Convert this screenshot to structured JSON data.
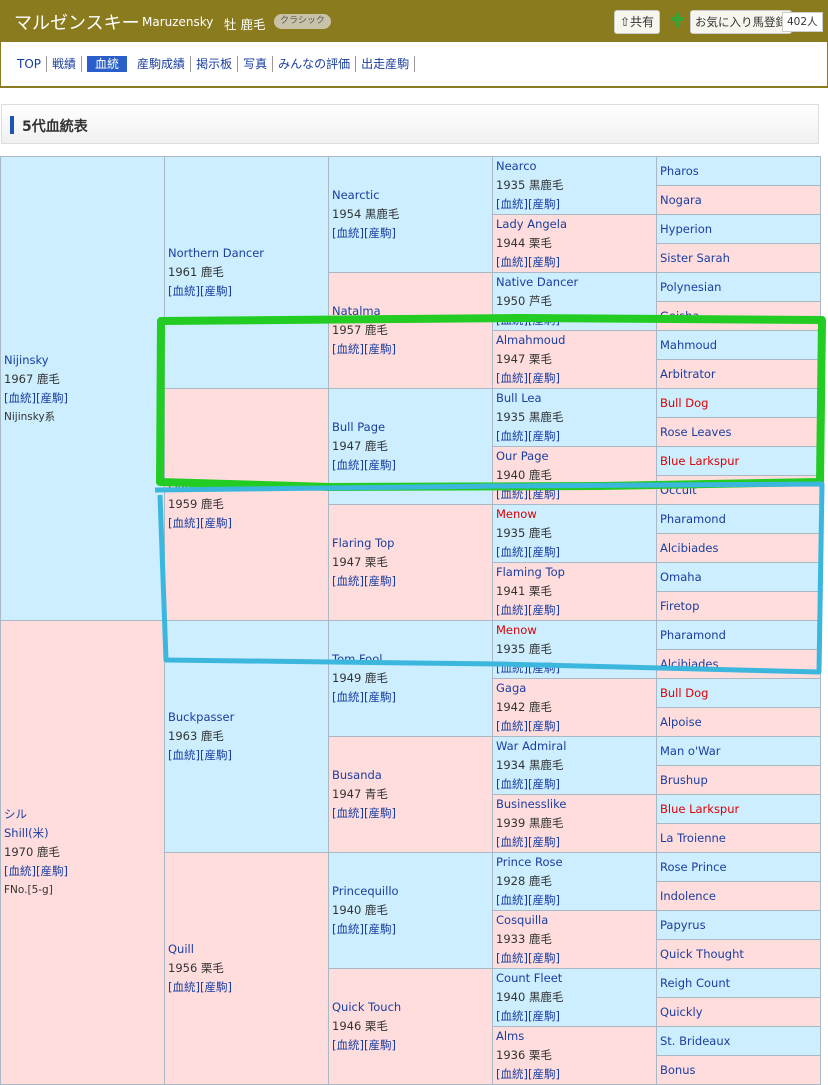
{
  "header": {
    "name": "マルゼンスキー",
    "roman": "Maruzensky",
    "sex_color": "牡 鹿毛",
    "badge": "クラシック",
    "share": "⇧共有",
    "favorite": "お気に入り馬登録",
    "fav_count": "402人"
  },
  "nav": [
    {
      "label": "TOP",
      "active": false
    },
    {
      "label": "戦績",
      "active": false
    },
    {
      "label": "血統",
      "active": true
    },
    {
      "label": "産駒成績",
      "active": false
    },
    {
      "label": "掲示板",
      "active": false
    },
    {
      "label": "写真",
      "active": false
    },
    {
      "label": "みんなの評価",
      "active": false
    },
    {
      "label": "出走産駒",
      "active": false
    }
  ],
  "section_title": "5代血統表",
  "links": {
    "pedigree": "血統",
    "progeny": "産駒"
  },
  "gen1": [
    {
      "name": "Nijinsky",
      "info": "1967 鹿毛",
      "extra": "Nijinsky系",
      "sex": "m"
    },
    {
      "kana": "シル",
      "name": "Shill(米)",
      "info": "1970 鹿毛",
      "extra": "FNo.[5-g]",
      "sex": "f"
    }
  ],
  "gen2": [
    {
      "name": "Northern Dancer",
      "info": "1961 鹿毛",
      "sex": "m"
    },
    {
      "name": "Flaming Page",
      "info": "1959 鹿毛",
      "sex": "f"
    },
    {
      "name": "Buckpasser",
      "info": "1963 鹿毛",
      "sex": "m"
    },
    {
      "name": "Quill",
      "info": "1956 栗毛",
      "sex": "f"
    }
  ],
  "gen3": [
    {
      "name": "Nearctic",
      "info": "1954 黒鹿毛",
      "sex": "m"
    },
    {
      "name": "Natalma",
      "info": "1957 鹿毛",
      "sex": "f"
    },
    {
      "name": "Bull Page",
      "info": "1947 鹿毛",
      "sex": "m"
    },
    {
      "name": "Flaring Top",
      "info": "1947 栗毛",
      "sex": "f"
    },
    {
      "name": "Tom Fool",
      "info": "1949 鹿毛",
      "sex": "m"
    },
    {
      "name": "Busanda",
      "info": "1947 青毛",
      "sex": "f"
    },
    {
      "name": "Princequillo",
      "info": "1940 鹿毛",
      "sex": "m"
    },
    {
      "name": "Quick Touch",
      "info": "1946 栗毛",
      "sex": "f"
    }
  ],
  "gen4": [
    {
      "name": "Nearco",
      "info": "1935 黒鹿毛",
      "sex": "m"
    },
    {
      "name": "Lady Angela",
      "info": "1944 栗毛",
      "sex": "f"
    },
    {
      "name": "Native Dancer",
      "info": "1950 芦毛",
      "sex": "m"
    },
    {
      "name": "Almahmoud",
      "info": "1947 栗毛",
      "sex": "f"
    },
    {
      "name": "Bull Lea",
      "info": "1935 黒鹿毛",
      "sex": "m"
    },
    {
      "name": "Our Page",
      "info": "1940 鹿毛",
      "sex": "f"
    },
    {
      "name": "Menow",
      "info": "1935 鹿毛",
      "sex": "m",
      "red": true
    },
    {
      "name": "Flaming Top",
      "info": "1941 栗毛",
      "sex": "f"
    },
    {
      "name": "Menow",
      "info": "1935 鹿毛",
      "sex": "m",
      "red": true
    },
    {
      "name": "Gaga",
      "info": "1942 鹿毛",
      "sex": "f"
    },
    {
      "name": "War Admiral",
      "info": "1934 黒鹿毛",
      "sex": "m"
    },
    {
      "name": "Businesslike",
      "info": "1939 黒鹿毛",
      "sex": "f"
    },
    {
      "name": "Prince Rose",
      "info": "1928 鹿毛",
      "sex": "m"
    },
    {
      "name": "Cosquilla",
      "info": "1933 鹿毛",
      "sex": "f"
    },
    {
      "name": "Count Fleet",
      "info": "1940 黒鹿毛",
      "sex": "m"
    },
    {
      "name": "Alms",
      "info": "1936 栗毛",
      "sex": "f"
    }
  ],
  "gen5": [
    {
      "name": "Pharos",
      "sex": "m"
    },
    {
      "name": "Nogara",
      "sex": "f"
    },
    {
      "name": "Hyperion",
      "sex": "m"
    },
    {
      "name": "Sister Sarah",
      "sex": "f"
    },
    {
      "name": "Polynesian",
      "sex": "m"
    },
    {
      "name": "Geisha",
      "sex": "f"
    },
    {
      "name": "Mahmoud",
      "sex": "m"
    },
    {
      "name": "Arbitrator",
      "sex": "f"
    },
    {
      "name": "Bull Dog",
      "sex": "m",
      "red": true
    },
    {
      "name": "Rose Leaves",
      "sex": "f"
    },
    {
      "name": "Blue Larkspur",
      "sex": "m",
      "red": true
    },
    {
      "name": "Occult",
      "sex": "f"
    },
    {
      "name": "Pharamond",
      "sex": "m"
    },
    {
      "name": "Alcibiades",
      "sex": "f"
    },
    {
      "name": "Omaha",
      "sex": "m"
    },
    {
      "name": "Firetop",
      "sex": "f"
    },
    {
      "name": "Pharamond",
      "sex": "m"
    },
    {
      "name": "Alcibiades",
      "sex": "f"
    },
    {
      "name": "Bull Dog",
      "sex": "m",
      "red": true
    },
    {
      "name": "Alpoise",
      "sex": "f"
    },
    {
      "name": "Man o'War",
      "sex": "m"
    },
    {
      "name": "Brushup",
      "sex": "f"
    },
    {
      "name": "Blue Larkspur",
      "sex": "m",
      "red": true
    },
    {
      "name": "La Troienne",
      "sex": "f"
    },
    {
      "name": "Rose Prince",
      "sex": "m"
    },
    {
      "name": "Indolence",
      "sex": "f"
    },
    {
      "name": "Papyrus",
      "sex": "m"
    },
    {
      "name": "Quick Thought",
      "sex": "f"
    },
    {
      "name": "Reigh Count",
      "sex": "m"
    },
    {
      "name": "Quickly",
      "sex": "f"
    },
    {
      "name": "St. Brideaux",
      "sex": "m"
    },
    {
      "name": "Bonus",
      "sex": "f"
    }
  ],
  "annotations": {
    "green": "#22cc22",
    "blue": "#3bb6dd"
  },
  "colors": {
    "male": "#cceeff",
    "female": "#ffdddd",
    "header": "#8a7b1f",
    "link": "#1a3ea0",
    "highlight": "#dd0000"
  }
}
